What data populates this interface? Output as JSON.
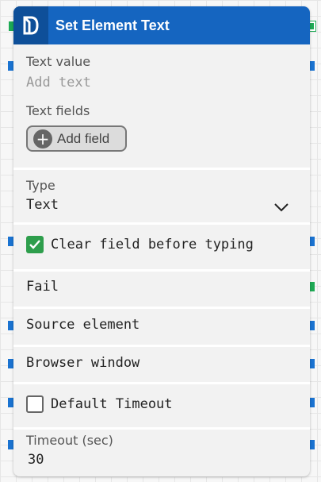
{
  "node": {
    "title": "Set Element Text",
    "logo_icon": "logo-icon",
    "header_color": "#1565c0"
  },
  "text_value": {
    "label": "Text value",
    "placeholder": "Add text"
  },
  "text_fields": {
    "label": "Text fields",
    "add_button": "Add field"
  },
  "type": {
    "label": "Type",
    "value": "Text"
  },
  "clear_field": {
    "label": "Clear field before typing",
    "checked": true
  },
  "fail": {
    "label": "Fail"
  },
  "source_element": {
    "label": "Source element"
  },
  "browser_window": {
    "label": "Browser window"
  },
  "default_timeout": {
    "label": "Default Timeout",
    "checked": false
  },
  "timeout": {
    "label": "Timeout (sec)",
    "value": "30"
  },
  "colors": {
    "port_input": "#1a73d1",
    "port_flow": "#1eaa55",
    "checkbox_checked": "#2e9e4c"
  }
}
